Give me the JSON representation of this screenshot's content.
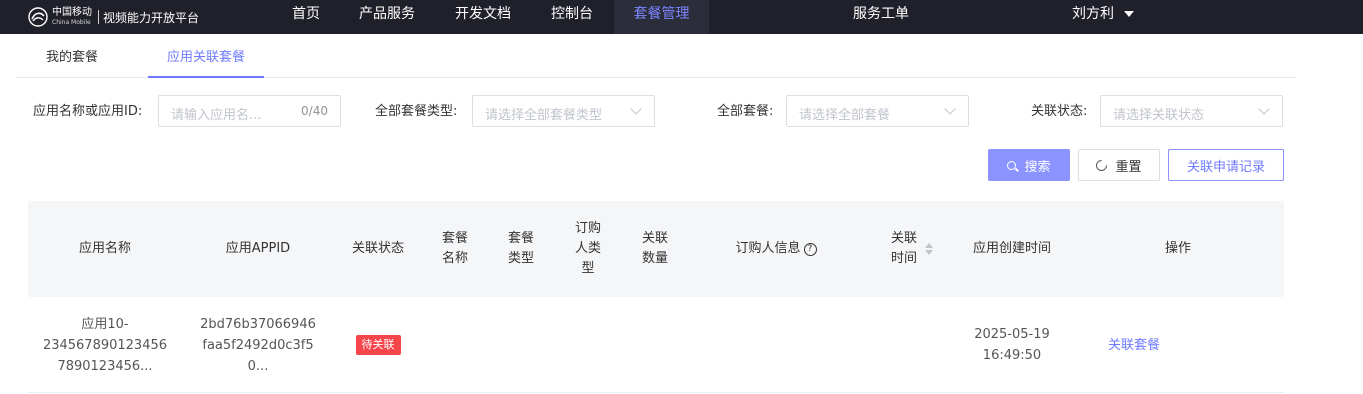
{
  "header": {
    "logo_cn": "中国移动",
    "logo_en": "China Mobile",
    "platform": "视频能力开放平台",
    "nav": [
      {
        "label": "首页"
      },
      {
        "label": "产品服务"
      },
      {
        "label": "开发文档"
      },
      {
        "label": "控制台"
      },
      {
        "label": "套餐管理",
        "active": true
      },
      {
        "label": "服务工单"
      }
    ],
    "user": "刘方利"
  },
  "tabs": [
    {
      "label": "我的套餐"
    },
    {
      "label": "应用关联套餐",
      "active": true
    }
  ],
  "filters": {
    "app": {
      "label": "应用名称或应用ID:",
      "placeholder": "请输入应用名...",
      "count": "0/40"
    },
    "type": {
      "label": "全部套餐类型:",
      "placeholder": "请选择全部套餐类型"
    },
    "package": {
      "label": "全部套餐:",
      "placeholder": "请选择全部套餐"
    },
    "status": {
      "label": "关联状态:",
      "placeholder": "请选择关联状态"
    }
  },
  "buttons": {
    "search": "搜索",
    "reset": "重置",
    "record": "关联申请记录"
  },
  "table": {
    "columns": {
      "app_name": "应用名称",
      "appid": "应用APPID",
      "status": "关联状态",
      "pkg_name_1": "套餐",
      "pkg_name_2": "名称",
      "pkg_type_1": "套餐",
      "pkg_type_2": "类型",
      "buyer_type_1": "订购",
      "buyer_type_2": "人类",
      "buyer_type_3": "型",
      "count_1": "关联",
      "count_2": "数量",
      "buyer_info": "订购人信息",
      "time_1": "关联",
      "time_2": "时间",
      "created": "应用创建时间",
      "ops": "操作"
    },
    "rows": [
      {
        "name_1": "应用10-",
        "name_2": "234567890123456",
        "name_3": "7890123456...",
        "appid_1": "2bd76b37066946",
        "appid_2": "faa5f2492d0c3f5",
        "appid_3": "0...",
        "status": "待关联",
        "created_date": "2025-05-19",
        "created_time": "16:49:50",
        "action": "关联套餐"
      }
    ]
  },
  "colors": {
    "nav_bg": "#1f2029",
    "accent": "#6f7bff",
    "badge": "#f5474b"
  }
}
